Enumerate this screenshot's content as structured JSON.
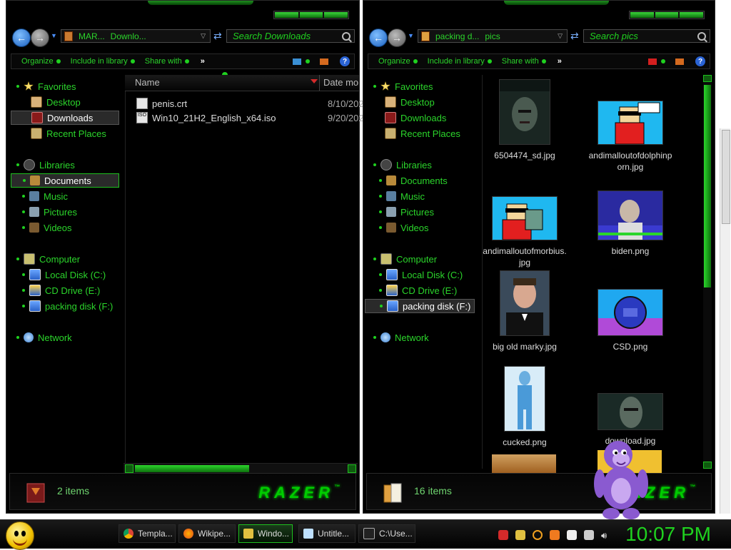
{
  "left_window": {
    "breadcrumb": [
      "MAR...",
      "Downlo..."
    ],
    "search_placeholder": "Search Downloads",
    "toolbar": {
      "organize": "Organize",
      "include": "Include in library",
      "share": "Share with",
      "more": "»",
      "help": "?"
    },
    "nav": {
      "favorites": "Favorites",
      "desktop": "Desktop",
      "downloads": "Downloads",
      "recent": "Recent Places",
      "libraries": "Libraries",
      "documents": "Documents",
      "music": "Music",
      "pictures": "Pictures",
      "videos": "Videos",
      "computer": "Computer",
      "local_disk": "Local Disk (C:)",
      "cd_drive": "CD Drive (E:)",
      "packing_disk": "packing disk (F:)",
      "network": "Network"
    },
    "columns": {
      "name": "Name",
      "date": "Date mo"
    },
    "files": [
      {
        "name": "penis.crt",
        "date": "8/10/202"
      },
      {
        "name": "Win10_21H2_English_x64.iso",
        "date": "9/20/202"
      }
    ],
    "status": "2 items",
    "logo": "RAZER"
  },
  "right_window": {
    "breadcrumb": [
      "packing d...",
      "pics"
    ],
    "search_placeholder": "Search pics",
    "toolbar": {
      "organize": "Organize",
      "include": "Include in library",
      "share": "Share with",
      "more": "»",
      "help": "?"
    },
    "nav": {
      "favorites": "Favorites",
      "desktop": "Desktop",
      "downloads": "Downloads",
      "recent": "Recent Places",
      "libraries": "Libraries",
      "documents": "Documents",
      "music": "Music",
      "pictures": "Pictures",
      "videos": "Videos",
      "computer": "Computer",
      "local_disk": "Local Disk (C:)",
      "cd_drive": "CD Drive (E:)",
      "packing_disk": "packing disk (F:)",
      "network": "Network"
    },
    "tiles": [
      {
        "label": "6504474_sd.jpg"
      },
      {
        "label": "andimalloutofdolphinporn.jpg"
      },
      {
        "label": "andimalloutofmorbius.jpg"
      },
      {
        "label": "biden.png"
      },
      {
        "label": "big old marky.jpg"
      },
      {
        "label": "CSD.png"
      },
      {
        "label": "cucked.png"
      },
      {
        "label": "download.jpg"
      }
    ],
    "status": "16 items",
    "logo": "RAZER"
  },
  "taskbar": {
    "tasks": [
      {
        "label": "Templa...",
        "icon": "chrome-icon"
      },
      {
        "label": "Wikipe...",
        "icon": "firefox-icon"
      },
      {
        "label": "Windo...",
        "icon": "folder-icon"
      },
      {
        "label": "Untitle...",
        "icon": "notepad-icon"
      },
      {
        "label": "C:\\Use...",
        "icon": "cmd-icon"
      }
    ],
    "clock": "10:07 PM"
  },
  "colors": {
    "accent_green": "#1fd11f",
    "background": "#000000",
    "taskbar_active_border": "#1fc01f"
  }
}
